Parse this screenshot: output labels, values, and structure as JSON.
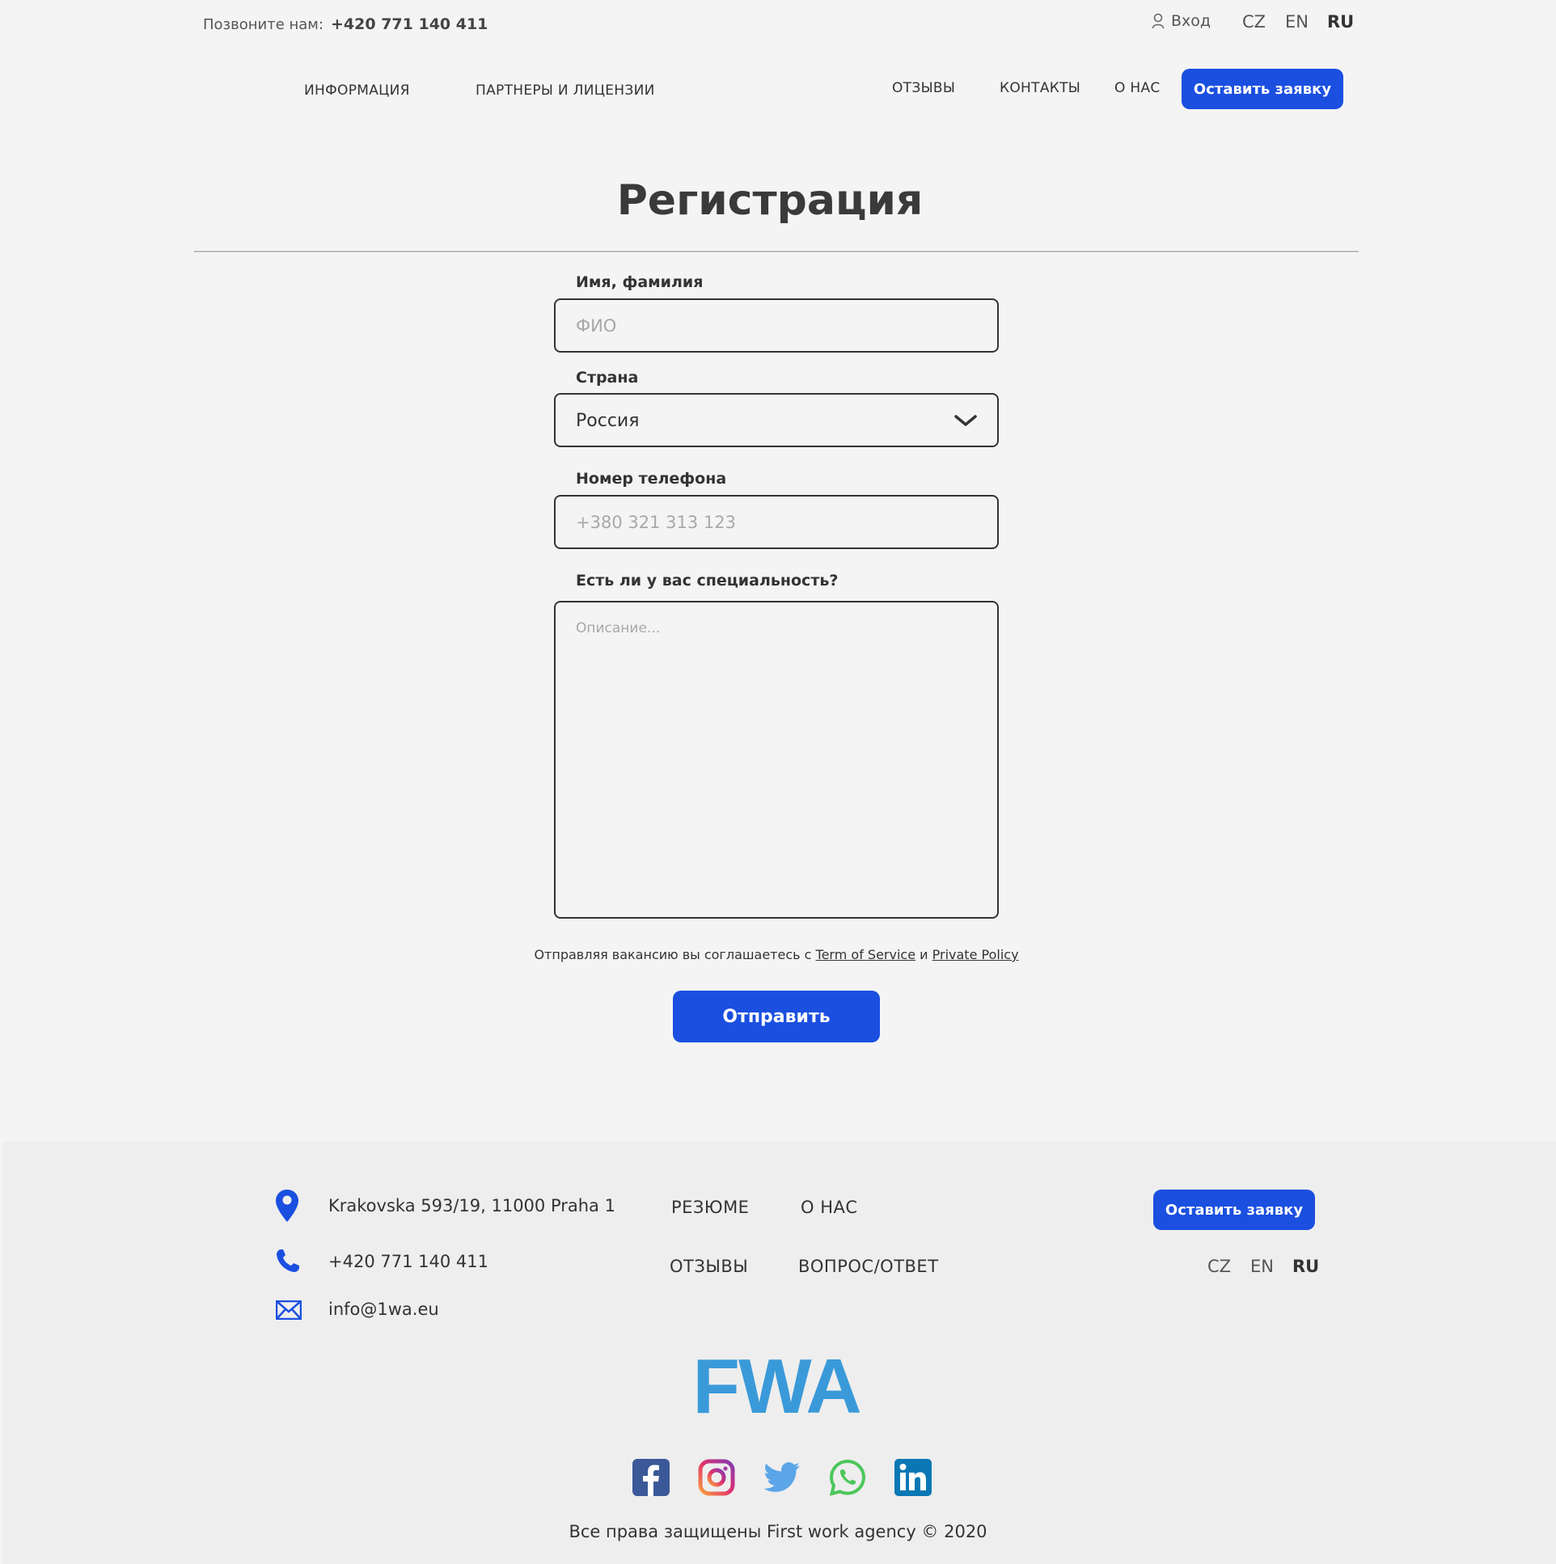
{
  "header": {
    "call_label": "Позвоните нам:",
    "call_number": "+420 771 140 411",
    "login_label": "Вход",
    "languages": [
      "CZ",
      "EN",
      "RU"
    ],
    "active_language": "RU"
  },
  "nav": {
    "left_items": [
      "ИНФОРМАЦИЯ",
      "ПАРТНЕРЫ И ЛИЦЕНЗИИ"
    ],
    "right_items": [
      "ОТЗЫВЫ",
      "КОНТАКТЫ",
      "О НАС"
    ],
    "cta_label": "Оставить заявку"
  },
  "page": {
    "title": "Регистрация"
  },
  "form": {
    "name_label": "Имя, фамилия",
    "name_placeholder": "ФИО",
    "country_label": "Страна",
    "country_value": "Россия",
    "phone_label": "Номер телефона",
    "phone_placeholder": "+380 321 313 123",
    "specialty_label": "Есть ли у вас специальность?",
    "specialty_placeholder": "Описание...",
    "consent_text": "Отправляя вакансию вы соглашаетесь с",
    "terms_link": "Term of Service",
    "consent_and": "и",
    "privacy_link": "Private Policy",
    "submit_label": "Отправить"
  },
  "footer": {
    "address": "Krakovska 593/19, 11000 Praha 1",
    "phone": "+420 771 140 411",
    "email": "info@1wa.eu",
    "nav_items": [
      "РЕЗЮМЕ",
      "О НАС",
      "ОТЗЫВЫ",
      "ВОПРОС/ОТВЕТ"
    ],
    "cta_label": "Оставить заявку",
    "languages": [
      "CZ",
      "EN",
      "RU"
    ],
    "logo_text": "FWA",
    "social": [
      "facebook-icon",
      "instagram-icon",
      "twitter-icon",
      "whatsapp-icon",
      "linkedin-icon"
    ],
    "copyright": "Все права защищены First work agency © 2020"
  },
  "colors": {
    "accent": "#1a4fe0",
    "logo": "#3a9ad9",
    "background": "#f4f4f4",
    "footer_background": "#eeeeee"
  }
}
